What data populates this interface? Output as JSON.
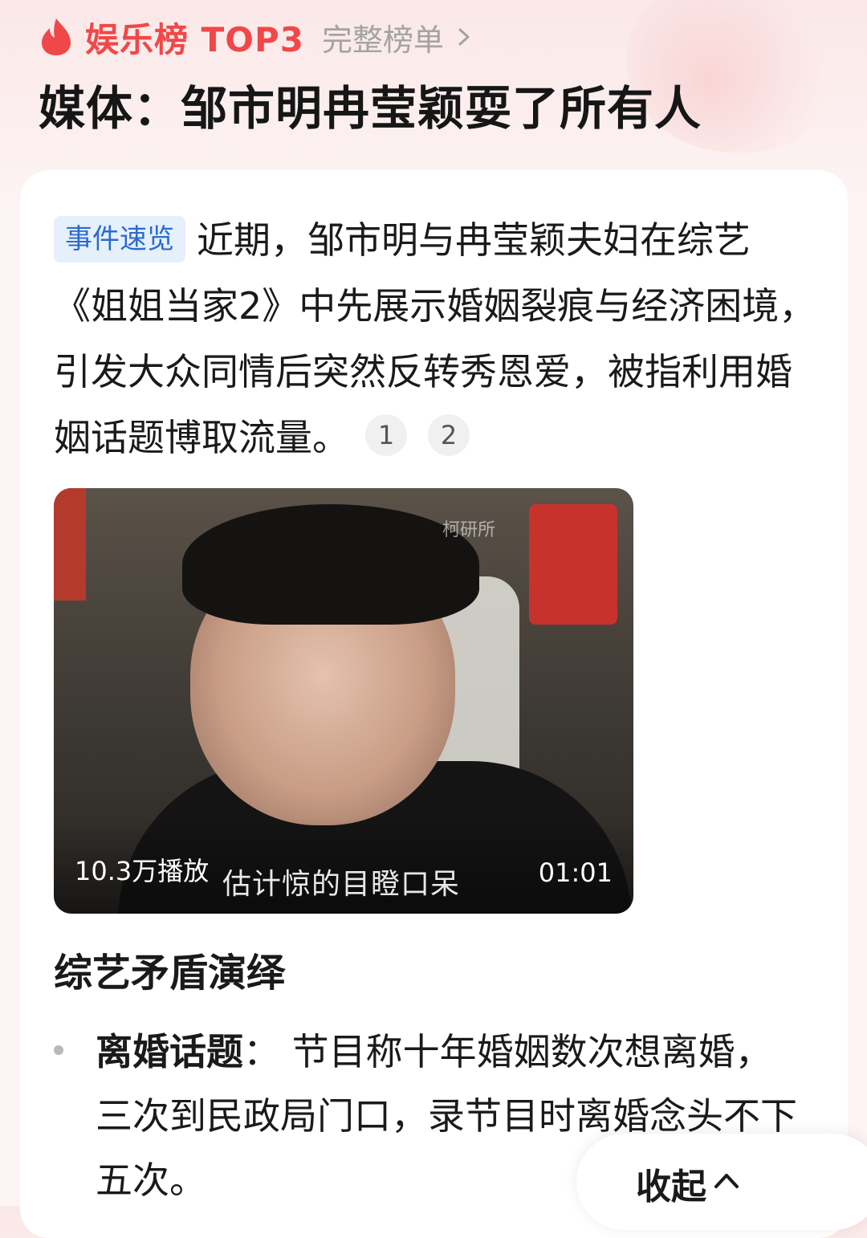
{
  "header": {
    "rank_label": "娱乐榜 TOP3",
    "full_list_label": "完整榜单",
    "headline": "媒体：邹市明冉莹颖耍了所有人"
  },
  "summary": {
    "tag": "事件速览",
    "text": "近期，邹市明与冉莹颖夫妇在综艺《姐姐当家2》中先展示婚姻裂痕与经济困境，引发大众同情后突然反转秀恩爱，被指利用婚姻话题博取流量。",
    "citations": [
      "1",
      "2"
    ]
  },
  "video": {
    "watermark": "柯研所",
    "plays": "10.3万播放",
    "caption": "估计惊的目瞪口呆",
    "duration": "01:01"
  },
  "section": {
    "title": "综艺矛盾演绎",
    "bullets": [
      {
        "key": "离婚话题",
        "sep": "：",
        "text": "节目称十年婚姻数次想离婚，三次到民政局门口，录节目时离婚念头不下五次。"
      }
    ]
  },
  "collapse": {
    "label": "收起"
  },
  "colors": {
    "accent_red": "#f04848",
    "tag_blue": "#2b6ad0",
    "tag_bg": "#e6f0fb"
  },
  "icons": {
    "fire": "fire-icon",
    "chevron_right": "chevron-right-icon",
    "chevron_up": "chevron-up-icon"
  }
}
